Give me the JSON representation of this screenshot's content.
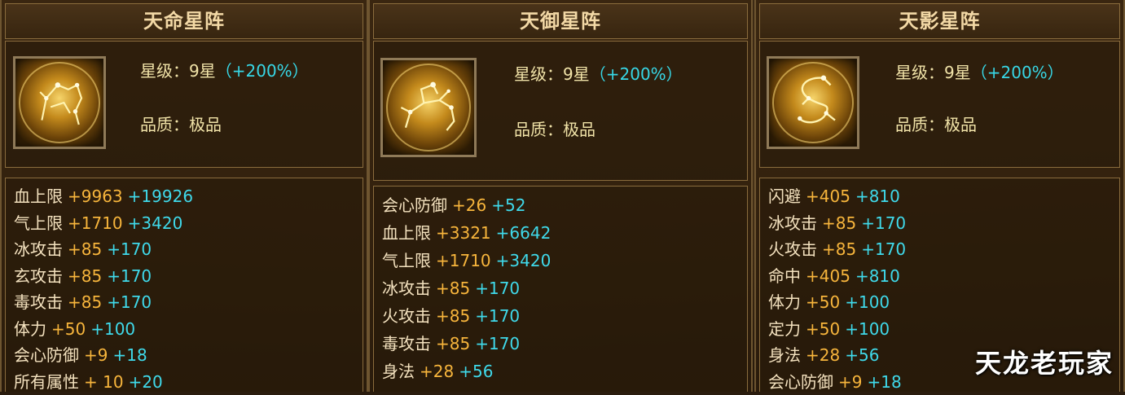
{
  "formations": [
    {
      "title": "天命星阵",
      "icon": "golden-lion-constellation",
      "star_label": "星级：9星",
      "star_bonus": "（+200%）",
      "quality_label": "品质：极品",
      "stats": [
        {
          "name": "血上限",
          "base": "+9963",
          "bonus": "+19926"
        },
        {
          "name": "气上限",
          "base": "+1710",
          "bonus": "+3420"
        },
        {
          "name": "冰攻击",
          "base": "+85",
          "bonus": "+170"
        },
        {
          "name": "玄攻击",
          "base": "+85",
          "bonus": "+170"
        },
        {
          "name": "毒攻击",
          "base": "+85",
          "bonus": "+170"
        },
        {
          "name": "体力",
          "base": "+50",
          "bonus": "+100"
        },
        {
          "name": "会心防御",
          "base": "+9",
          "bonus": "+18"
        },
        {
          "name": "所有属性",
          "base": "+ 10",
          "bonus": "+20"
        }
      ]
    },
    {
      "title": "天御星阵",
      "icon": "golden-beast-constellation",
      "star_label": "星级：9星",
      "star_bonus": "（+200%）",
      "quality_label": "品质：极品",
      "stats": [
        {
          "name": "会心防御",
          "base": "+26",
          "bonus": "+52"
        },
        {
          "name": "血上限",
          "base": "+3321",
          "bonus": "+6642"
        },
        {
          "name": "气上限",
          "base": "+1710",
          "bonus": "+3420"
        },
        {
          "name": "冰攻击",
          "base": "+85",
          "bonus": "+170"
        },
        {
          "name": "火攻击",
          "base": "+85",
          "bonus": "+170"
        },
        {
          "name": "毒攻击",
          "base": "+85",
          "bonus": "+170"
        },
        {
          "name": "身法",
          "base": "+28",
          "bonus": "+56"
        }
      ]
    },
    {
      "title": "天影星阵",
      "icon": "golden-dragon-constellation",
      "star_label": "星级：9星",
      "star_bonus": "（+200%）",
      "quality_label": "品质：极品",
      "stats": [
        {
          "name": "闪避",
          "base": "+405",
          "bonus": "+810"
        },
        {
          "name": "冰攻击",
          "base": "+85",
          "bonus": "+170"
        },
        {
          "name": "火攻击",
          "base": "+85",
          "bonus": "+170"
        },
        {
          "name": "命中",
          "base": "+405",
          "bonus": "+810"
        },
        {
          "name": "体力",
          "base": "+50",
          "bonus": "+100"
        },
        {
          "name": "定力",
          "base": "+50",
          "bonus": "+100"
        },
        {
          "name": "身法",
          "base": "+28",
          "bonus": "+56"
        },
        {
          "name": "会心防御",
          "base": "+9",
          "bonus": "+18"
        }
      ]
    }
  ],
  "watermark": "天龙老玩家",
  "colors": {
    "title_text": "#f3d9a6",
    "stat_name": "#f4e2bf",
    "stat_base": "#f7b53c",
    "stat_bonus": "#3fd9ea",
    "star_bonus": "#37d7e6",
    "frame_border": "#8a6c3d"
  }
}
